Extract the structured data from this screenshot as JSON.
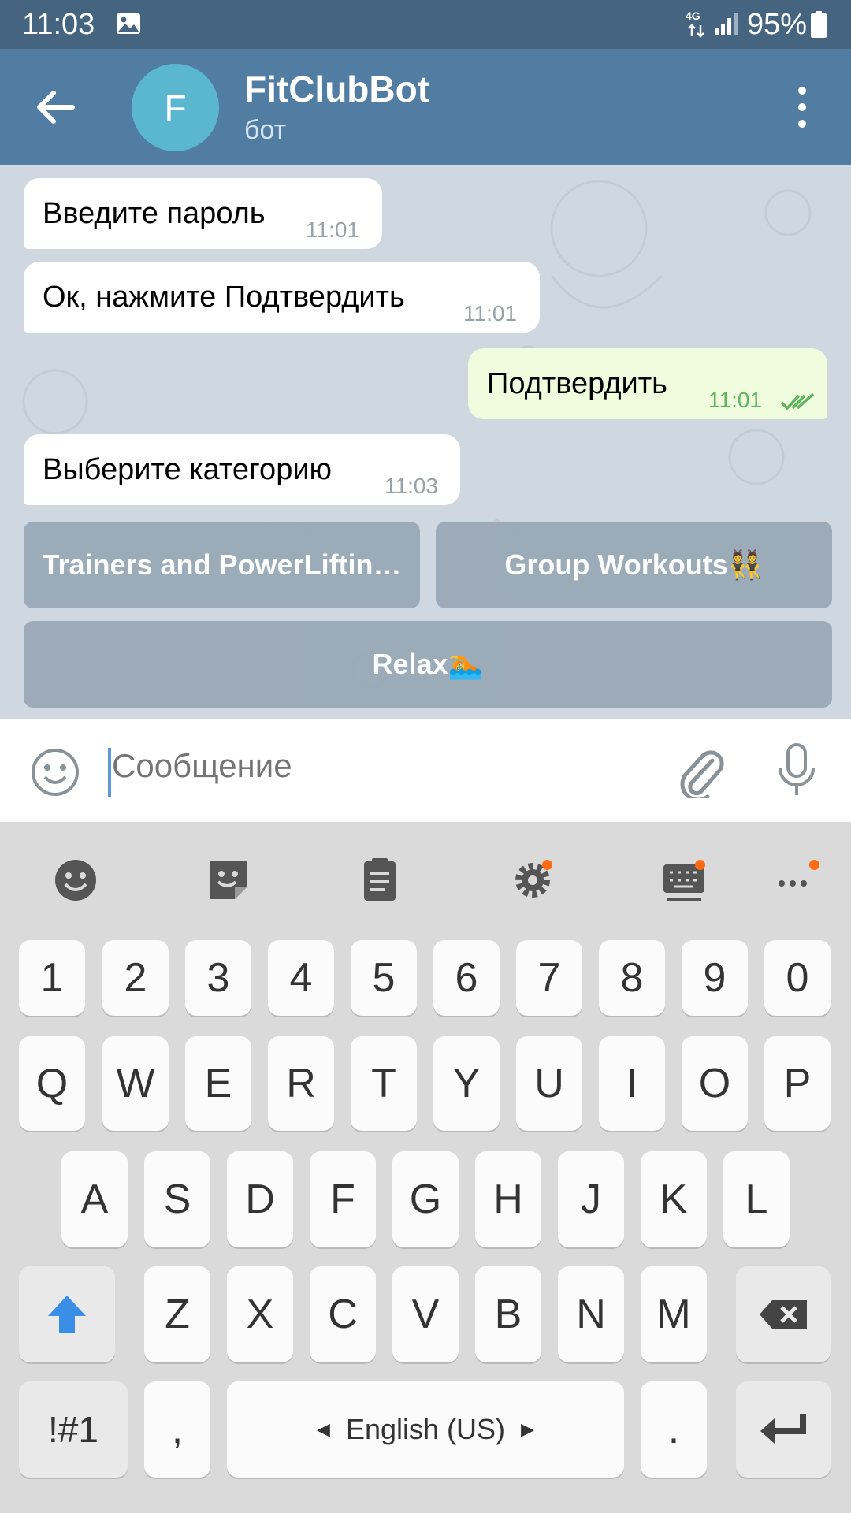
{
  "status_bar": {
    "time": "11:03",
    "network": "4G",
    "battery": "95%"
  },
  "header": {
    "avatar_letter": "F",
    "title": "FitClubBot",
    "subtitle": "бот"
  },
  "messages": [
    {
      "direction": "in",
      "text": "Введите пароль",
      "time": "11:01"
    },
    {
      "direction": "in",
      "text": "Ок, нажмите Подтвердить",
      "time": "11:01"
    },
    {
      "direction": "out",
      "text": "Подтвердить",
      "time": "11:01",
      "status": "read"
    },
    {
      "direction": "in",
      "text": "Выберите категорию",
      "time": "11:03"
    }
  ],
  "bot_keyboard": {
    "buttons": [
      {
        "label": "Trainers and PowerLiftin…"
      },
      {
        "label": "Group Workouts👯"
      },
      {
        "label": "Relax🏊"
      }
    ]
  },
  "input": {
    "placeholder": "Сообщение",
    "value": ""
  },
  "keyboard": {
    "toolbar": [
      "emoji-icon",
      "sticker-icon",
      "clipboard-icon",
      "settings-icon",
      "keyboard-icon",
      "more-icon"
    ],
    "number_row": [
      "1",
      "2",
      "3",
      "4",
      "5",
      "6",
      "7",
      "8",
      "9",
      "0"
    ],
    "row1": [
      "Q",
      "W",
      "E",
      "R",
      "T",
      "Y",
      "U",
      "I",
      "O",
      "P"
    ],
    "row2": [
      "A",
      "S",
      "D",
      "F",
      "G",
      "H",
      "J",
      "K",
      "L"
    ],
    "row3": [
      "Z",
      "X",
      "C",
      "V",
      "B",
      "N",
      "M"
    ],
    "symbols_label": "!#1",
    "comma_label": ",",
    "space_label": "English (US)",
    "period_label": ".",
    "accent_color": "#3a8ee6",
    "notification_dot_color": "#ff6a12"
  },
  "colors": {
    "header": "#517da2",
    "status_bar": "#45647f",
    "out_bubble": "#effdde",
    "chat_bg": "#cfd8e1"
  }
}
